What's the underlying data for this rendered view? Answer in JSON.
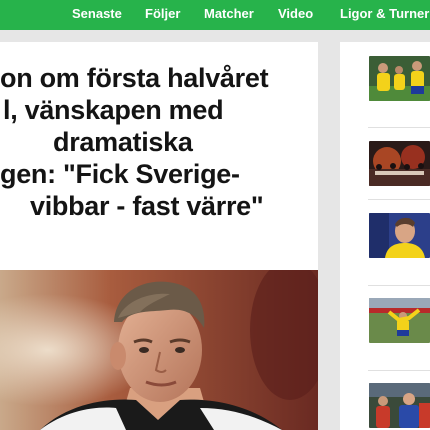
{
  "nav": {
    "items": [
      "Senaste",
      "Följer",
      "Matcher",
      "Video",
      "Ligor & Turnering"
    ],
    "color": "#27b34b"
  },
  "article": {
    "headline_lines": [
      "on om första halvåret",
      "l, vänskapen med",
      "dramatiska",
      "gen: \"Fick Sverige-",
      "vibbar - fast värre\""
    ]
  },
  "sidebar": {
    "thumbnails": [
      "yellow-team-celebration",
      "fans-with-flares",
      "player-in-yellow-kit",
      "player-celebrating-on-pitch",
      "players-in-red-and-blue"
    ]
  }
}
